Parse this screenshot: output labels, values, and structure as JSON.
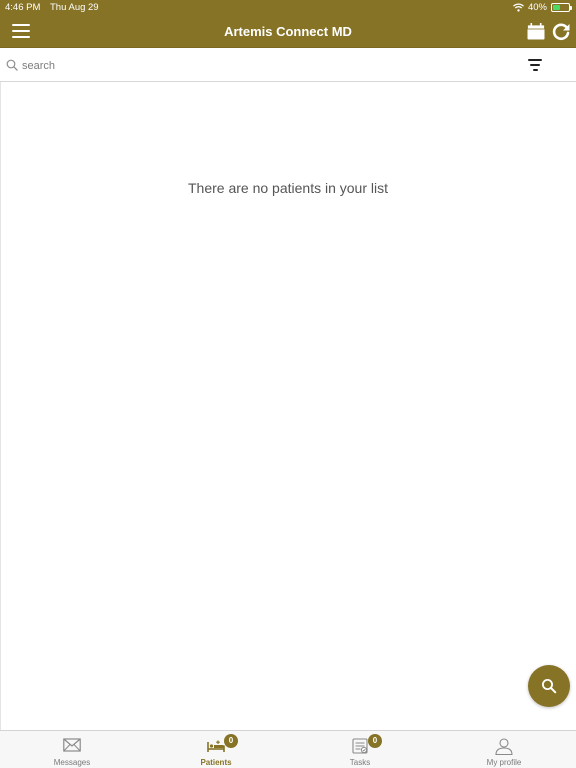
{
  "status_bar": {
    "time": "4:46 PM",
    "date": "Thu Aug 29",
    "battery": "40%",
    "battery_level": 0.4
  },
  "header": {
    "title": "Artemis Connect MD",
    "background_color": "#867326"
  },
  "search": {
    "placeholder": "search",
    "value": ""
  },
  "main": {
    "empty_message": "There are no patients in your list"
  },
  "tabs": [
    {
      "label": "Messages",
      "icon": "envelope-icon",
      "badge": null,
      "active": false
    },
    {
      "label": "Patients",
      "icon": "bed-icon",
      "badge": "0",
      "active": true
    },
    {
      "label": "Tasks",
      "icon": "checklist-icon",
      "badge": "0",
      "active": false
    },
    {
      "label": "My profile",
      "icon": "person-icon",
      "badge": null,
      "active": false
    }
  ],
  "accent_color": "#867326"
}
